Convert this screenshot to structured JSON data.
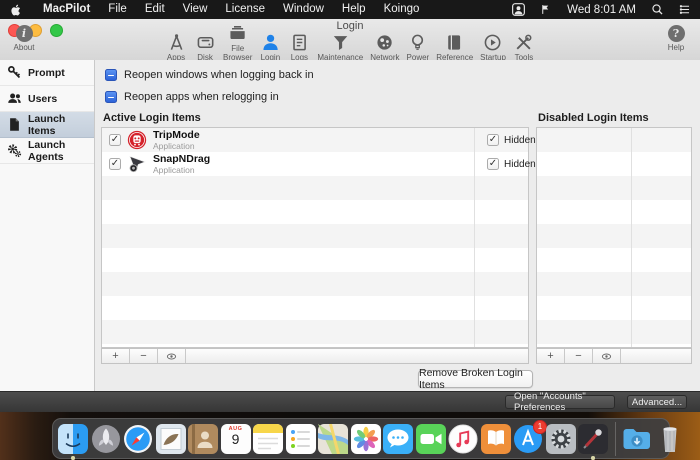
{
  "menu_bar": {
    "app_name": "MacPilot",
    "items": [
      "File",
      "Edit",
      "View",
      "License",
      "Window",
      "Help",
      "Koingo"
    ],
    "status_icons": [
      "user-switching-icon",
      "flag-icon"
    ],
    "clock": "Wed 8:01 AM",
    "right_icons": [
      "spotlight-icon",
      "notification-center-icon"
    ]
  },
  "window": {
    "title": "Login",
    "toolbar": {
      "about": {
        "label": "About",
        "glyph": "i"
      },
      "help": {
        "label": "Help",
        "glyph": "?"
      },
      "items": [
        {
          "label": "Apps",
          "icon": "apps-icon",
          "selected": false
        },
        {
          "label": "Disk",
          "icon": "disk-icon",
          "selected": false
        },
        {
          "label": "File Browser",
          "icon": "file-browser-icon",
          "selected": false
        },
        {
          "label": "Login",
          "icon": "login-icon",
          "selected": true
        },
        {
          "label": "Logs",
          "icon": "logs-icon",
          "selected": false
        },
        {
          "label": "Maintenance",
          "icon": "maintenance-icon",
          "selected": false
        },
        {
          "label": "Network",
          "icon": "network-icon",
          "selected": false
        },
        {
          "label": "Power",
          "icon": "power-icon",
          "selected": false
        },
        {
          "label": "Reference",
          "icon": "reference-icon",
          "selected": false
        },
        {
          "label": "Startup",
          "icon": "startup-icon",
          "selected": false
        },
        {
          "label": "Tools",
          "icon": "tools-icon",
          "selected": false
        }
      ]
    },
    "sidebar": {
      "items": [
        {
          "label": "Prompt",
          "icon": "key-icon",
          "selected": false
        },
        {
          "label": "Users",
          "icon": "users-icon",
          "selected": false
        },
        {
          "label": "Launch Items",
          "icon": "document-icon",
          "selected": true
        },
        {
          "label": "Launch Agents",
          "icon": "gears-icon",
          "selected": false
        }
      ]
    },
    "checkboxes": [
      {
        "label": "Reopen windows when logging back in",
        "state": "mixed"
      },
      {
        "label": "Reopen apps when relogging in",
        "state": "mixed"
      }
    ],
    "active_list": {
      "title": "Active Login Items",
      "rows": [
        {
          "checked": true,
          "icon": "tripmode-app-icon",
          "name": "TripMode",
          "kind": "Application",
          "hidden_checked": true,
          "hidden_label": "Hidden"
        },
        {
          "checked": true,
          "icon": "snapndrag-app-icon",
          "name": "SnapNDrag",
          "kind": "Application",
          "hidden_checked": true,
          "hidden_label": "Hidden"
        }
      ],
      "controls": [
        {
          "name": "add-button",
          "glyph": "+"
        },
        {
          "name": "remove-button",
          "glyph": "−"
        },
        {
          "name": "reveal-button",
          "glyph": "eye-icon"
        }
      ]
    },
    "disabled_list": {
      "title": "Disabled Login Items",
      "rows": [],
      "controls": [
        {
          "name": "add-button",
          "glyph": "+"
        },
        {
          "name": "remove-button",
          "glyph": "−"
        },
        {
          "name": "reveal-button",
          "glyph": "eye-icon"
        }
      ]
    },
    "remove_broken_button": "Remove Broken Login Items",
    "footer_buttons": [
      {
        "label": "Open \"Accounts\" Preferences",
        "name": "open-accounts-preferences-button"
      },
      {
        "label": "Advanced...",
        "name": "advanced-button"
      }
    ]
  },
  "dock": {
    "items": [
      {
        "name": "finder",
        "icon": "finder-icon",
        "color": "#2b9cf2",
        "running": true
      },
      {
        "name": "launchpad",
        "icon": "launchpad-icon",
        "color": "#9a9aa0",
        "running": false
      },
      {
        "name": "safari",
        "icon": "safari-icon",
        "color": "#2a9bf5",
        "running": false
      },
      {
        "name": "mail",
        "icon": "mail-icon",
        "color": "#dfe7ee",
        "running": false
      },
      {
        "name": "contacts",
        "icon": "contacts-icon",
        "color": "#b08a5e",
        "running": false
      },
      {
        "name": "calendar",
        "icon": "calendar-icon",
        "color": "#ffffff",
        "month": "AUG",
        "day": "9",
        "running": false
      },
      {
        "name": "notes",
        "icon": "notes-icon",
        "color": "#f7d64a",
        "running": false
      },
      {
        "name": "reminders",
        "icon": "reminders-icon",
        "color": "#ffffff",
        "running": false
      },
      {
        "name": "maps",
        "icon": "maps-icon",
        "color": "#bcd98a",
        "running": false
      },
      {
        "name": "photos",
        "icon": "photos-icon",
        "color": "#ffffff",
        "running": false
      },
      {
        "name": "messages",
        "icon": "messages-icon",
        "color": "#3ab0f8",
        "running": false
      },
      {
        "name": "facetime",
        "icon": "facetime-icon",
        "color": "#59d359",
        "running": false
      },
      {
        "name": "itunes",
        "icon": "itunes-icon",
        "color": "#e73b57",
        "running": false
      },
      {
        "name": "ibooks",
        "icon": "ibooks-icon",
        "color": "#ef8f3a",
        "running": false
      },
      {
        "name": "app-store",
        "icon": "appstore-icon",
        "color": "#2a9bf5",
        "badge": "1",
        "running": false
      },
      {
        "name": "system-preferences",
        "icon": "sysprefs-icon",
        "color": "#b9bdc2",
        "running": false
      },
      {
        "name": "macpilot",
        "icon": "macpilot-icon",
        "color": "#2c2c31",
        "running": true
      },
      {
        "name": "divider",
        "icon": "divider",
        "running": false
      },
      {
        "name": "downloads",
        "icon": "downloads-icon",
        "color": "#55aee8",
        "running": false
      },
      {
        "name": "trash",
        "icon": "trash-icon",
        "color": "#c9ccd1",
        "running": false
      }
    ]
  },
  "colors": {
    "accent_blue": "#2c63d8",
    "login_icon_blue": "#1f82e8",
    "tripmode_red": "#d5222b",
    "sidebar_selected": "#c9d4e0",
    "badge_red": "#ec3b2f"
  }
}
